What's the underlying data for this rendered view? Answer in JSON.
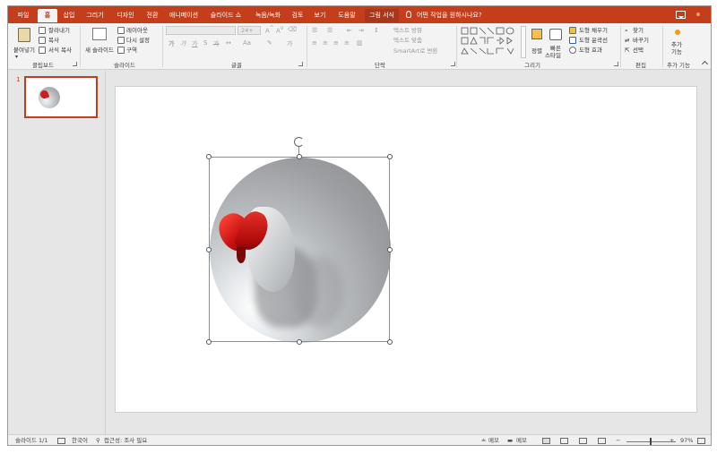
{
  "tabs": {
    "file": "파일",
    "home": "홈",
    "insert": "삽입",
    "draw": "그리기",
    "design": "디자인",
    "transitions": "전환",
    "animations": "애니메이션",
    "slideshow": "슬라이드 쇼",
    "record": "녹음/녹화",
    "review": "검토",
    "view": "보기",
    "help": "도움말",
    "picture_format": "그림 서식"
  },
  "tell_me": "어떤 작업을 원하시나요?",
  "ribbon": {
    "clipboard": {
      "paste": "붙여넣기",
      "cut": "잘라내기",
      "copy": "복사",
      "format_painter": "서식 복사",
      "label": "클립보드"
    },
    "slides": {
      "new_slide": "새 슬라이드",
      "layout": "레이아웃",
      "reset": "다시 설정",
      "section": "구역",
      "label": "슬라이드"
    },
    "font": {
      "size": "24+",
      "label": "글꼴"
    },
    "paragraph": {
      "text_direction": "텍스트 방향",
      "align_text": "텍스트 맞춤",
      "smartart": "SmartArt로 변환",
      "label": "단락"
    },
    "drawing": {
      "arrange": "정렬",
      "quick_styles_1": "빠른",
      "quick_styles_2": "스타일",
      "shape_fill": "도형 채우기",
      "shape_outline": "도형 윤곽선",
      "shape_effects": "도형 효과",
      "label": "그리기"
    },
    "editing": {
      "find": "찾기",
      "replace": "바꾸기",
      "select": "선택",
      "label": "편집"
    },
    "addins": {
      "addins_1": "추가",
      "addins_2": "기능",
      "label": "추가 기능"
    }
  },
  "thumbnails": [
    {
      "number": "1"
    }
  ],
  "statusbar": {
    "slide_info": "슬라이드 1/1",
    "language": "한국어",
    "accessibility": "접근성: 조사 필요",
    "notes": "메모",
    "comments": "메모",
    "zoom": "97%"
  },
  "colors": {
    "accent": "#c43e1c",
    "ribbon_bg": "#f3f3f3",
    "workspace_bg": "#e6e6e6"
  }
}
